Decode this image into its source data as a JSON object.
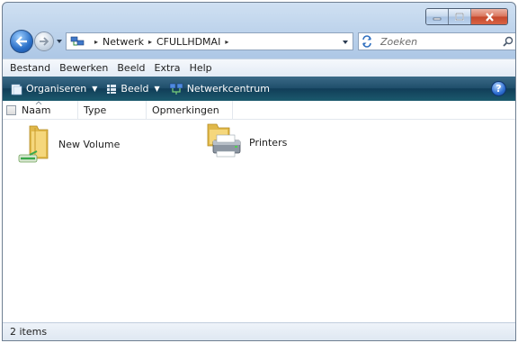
{
  "window": {
    "caption_colors": {
      "frame": "#aec8e6",
      "close": "#c5472b"
    }
  },
  "nav": {
    "breadcrumb": [
      "Netwerk",
      "CFULLHDMAI"
    ],
    "search_placeholder": "Zoeken"
  },
  "menu": {
    "items": [
      "Bestand",
      "Bewerken",
      "Beeld",
      "Extra",
      "Help"
    ]
  },
  "commands": {
    "organize": "Organiseren",
    "view": "Beeld",
    "network_center": "Netwerkcentrum",
    "help_icon": "?"
  },
  "columns": {
    "name": "Naam",
    "type": "Type",
    "notes": "Opmerkingen"
  },
  "items": [
    {
      "label": "New Volume",
      "icon": "shared-folder-icon"
    },
    {
      "label": "Printers",
      "icon": "printers-folder-icon"
    }
  ],
  "status": {
    "count_text": "2 items"
  }
}
